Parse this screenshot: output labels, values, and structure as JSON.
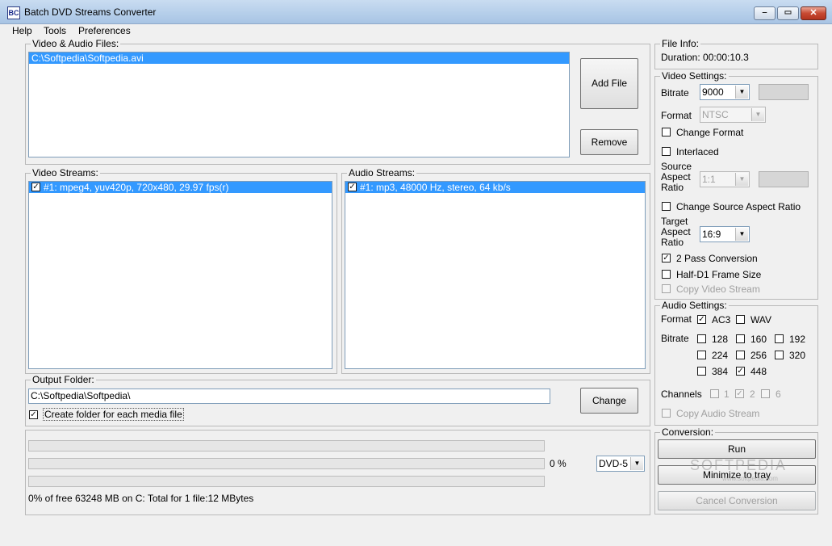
{
  "window": {
    "title": "Batch DVD Streams Converter",
    "icon_label": "BC"
  },
  "menu": {
    "help": "Help",
    "tools": "Tools",
    "preferences": "Preferences"
  },
  "files": {
    "legend": "Video & Audio Files:",
    "items": [
      "C:\\Softpedia\\Softpedia.avi"
    ],
    "add_label": "Add File",
    "remove_label": "Remove"
  },
  "video_streams": {
    "legend": "Video Streams:",
    "items": [
      {
        "label": "#1: mpeg4, yuv420p, 720x480, 29.97 fps(r)",
        "checked": true
      }
    ]
  },
  "audio_streams": {
    "legend": "Audio Streams:",
    "items": [
      {
        "label": "#1: mp3, 48000 Hz, stereo, 64 kb/s",
        "checked": true
      }
    ]
  },
  "output": {
    "legend": "Output Folder:",
    "path": "C:\\Softpedia\\Softpedia\\",
    "change_label": "Change",
    "create_folder_label": "Create folder for each media file",
    "create_folder_checked": true
  },
  "progress": {
    "percent_text": "0 %",
    "disc_type": "DVD-5",
    "status_text": "0% of free 63248 MB on C: Total for 1 file:12 MBytes"
  },
  "file_info": {
    "legend": "File Info:",
    "duration": "Duration: 00:00:10.3"
  },
  "video_settings": {
    "legend": "Video Settings:",
    "bitrate_label": "Bitrate",
    "bitrate_value": "9000",
    "format_label": "Format",
    "format_value": "NTSC",
    "change_format_label": "Change Format",
    "change_format_checked": false,
    "interlaced_label": "Interlaced",
    "interlaced_checked": false,
    "source_aspect_label_1": "Source",
    "source_aspect_label_2": "Aspect",
    "source_aspect_label_3": "Ratio",
    "source_aspect_value": "1:1",
    "change_source_aspect_label": "Change Source Aspect Ratio",
    "change_source_aspect_checked": false,
    "target_aspect_label_1": "Target",
    "target_aspect_label_2": "Aspect",
    "target_aspect_label_3": "Ratio",
    "target_aspect_value": "16:9",
    "two_pass_label": "2 Pass Conversion",
    "two_pass_checked": true,
    "half_d1_label": "Half-D1 Frame Size",
    "half_d1_checked": false,
    "copy_video_label": "Copy Video Stream",
    "copy_video_checked": false
  },
  "audio_settings": {
    "legend": "Audio Settings:",
    "format_label": "Format",
    "ac3_label": "AC3",
    "ac3_checked": true,
    "wav_label": "WAV",
    "wav_checked": false,
    "bitrate_label": "Bitrate",
    "bitrates": [
      {
        "label": "128",
        "checked": false
      },
      {
        "label": "160",
        "checked": false
      },
      {
        "label": "192",
        "checked": false
      },
      {
        "label": "224",
        "checked": false
      },
      {
        "label": "256",
        "checked": false
      },
      {
        "label": "320",
        "checked": false
      },
      {
        "label": "384",
        "checked": false
      },
      {
        "label": "448",
        "checked": true
      }
    ],
    "channels_label": "Channels",
    "channels": [
      {
        "label": "1",
        "checked": false
      },
      {
        "label": "2",
        "checked": true
      },
      {
        "label": "6",
        "checked": false
      }
    ],
    "copy_audio_label": "Copy Audio Stream",
    "copy_audio_checked": false
  },
  "conversion": {
    "legend": "Conversion:",
    "run_label": "Run",
    "minimize_label": "Minimize to tray",
    "cancel_label": "Cancel Conversion"
  },
  "watermark": {
    "text": "SOFTPEDIA",
    "url": "www.softpedia.com"
  }
}
